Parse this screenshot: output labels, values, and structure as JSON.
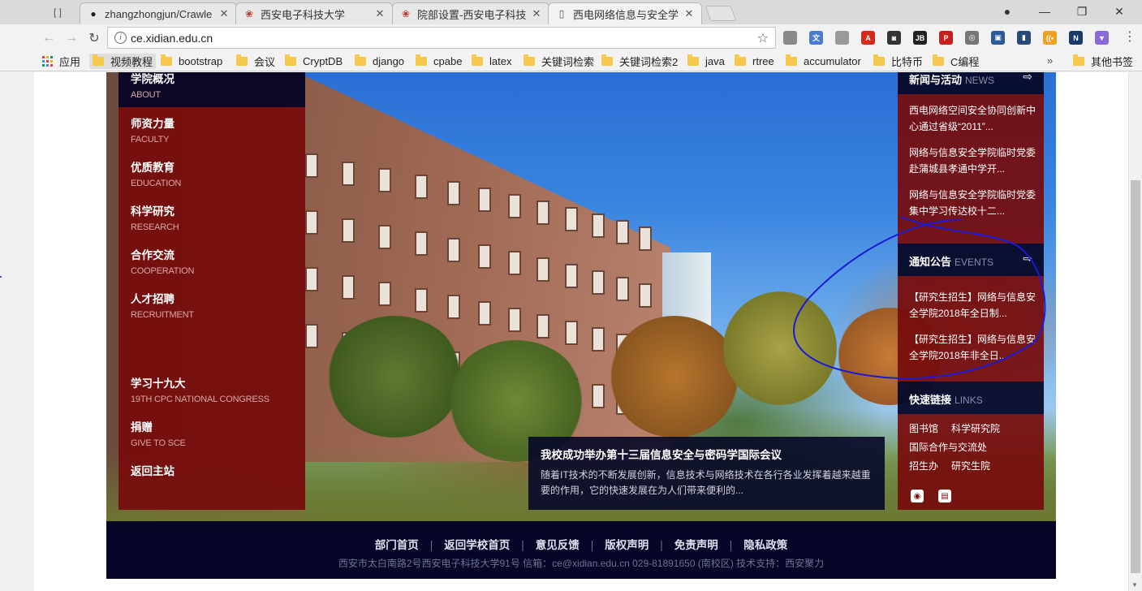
{
  "browser": {
    "tabs": [
      {
        "title": "zhangzhongjun/Crawle",
        "icon": "github-icon",
        "active": false
      },
      {
        "title": "西安电子科技大学",
        "icon": "xidian-logo-icon",
        "active": false
      },
      {
        "title": "院部设置-西安电子科技大",
        "icon": "xidian-logo-icon",
        "active": false
      },
      {
        "title": "西电网络信息与安全学院",
        "icon": "page-icon",
        "active": true
      }
    ],
    "url": "ce.xidian.edu.cn",
    "bookmarks": {
      "apps_label": "应用",
      "items": [
        "视频教程",
        "bootstrap",
        "会议",
        "CryptDB",
        "django",
        "cpabe",
        "latex",
        "关键词检索",
        "关键词检索2",
        "java",
        "rtree",
        "accumulator",
        "比特币",
        "C编程"
      ],
      "more": "»",
      "other": "其他书签"
    },
    "extensions": [
      {
        "name": "shield-ext-icon",
        "color": "#8a8a8a",
        "text": ""
      },
      {
        "name": "translate-ext-icon",
        "color": "#4a7bd4",
        "text": "文"
      },
      {
        "name": "image-ext-icon",
        "color": "#9a9a9a",
        "text": ""
      },
      {
        "name": "pdf-ext-icon",
        "color": "#d42a1e",
        "text": "A"
      },
      {
        "name": "glasses-ext-icon",
        "color": "#333333",
        "text": "◙"
      },
      {
        "name": "jb-ext-icon",
        "color": "#222222",
        "text": "JB"
      },
      {
        "name": "pdf2-ext-icon",
        "color": "#c81e1e",
        "text": "P"
      },
      {
        "name": "globe-ext-icon",
        "color": "#777777",
        "text": "◎"
      },
      {
        "name": "camera-ext-icon",
        "color": "#2a5a9a",
        "text": "▣"
      },
      {
        "name": "chart-ext-icon",
        "color": "#2a4a7a",
        "text": "▮"
      },
      {
        "name": "rss-ext-icon",
        "color": "#f0a020",
        "text": "((•"
      },
      {
        "name": "n-ext-icon",
        "color": "#1a3a6a",
        "text": "N"
      },
      {
        "name": "vue-ext-icon",
        "color": "#8a6ad8",
        "text": "▼"
      }
    ]
  },
  "site": {
    "leftnav": {
      "top": {
        "zh": "学院概况",
        "en": "ABOUT"
      },
      "items": [
        {
          "zh": "师资力量",
          "en": "FACULTY"
        },
        {
          "zh": "优质教育",
          "en": "EDUCATION"
        },
        {
          "zh": "科学研究",
          "en": "RESEARCH"
        },
        {
          "zh": "合作交流",
          "en": "COOPERATION"
        },
        {
          "zh": "人才招聘",
          "en": "RECRUITMENT"
        },
        {
          "zh": "学习十九大",
          "en": "19TH CPC NATIONAL CONGRESS"
        },
        {
          "zh": "捐赠",
          "en": "GIVE TO SCE"
        },
        {
          "zh": "返回主站",
          "en": ""
        }
      ]
    },
    "news": {
      "title": "新闻与活动",
      "title_en": "NEWS",
      "arrow": "⇨",
      "items": [
        "西电网络空间安全协同创新中心通过省级“2011”...",
        "网络与信息安全学院临时党委赴蒲城县孝通中学开...",
        "网络与信息安全学院临时党委集中学习传达校十二..."
      ]
    },
    "events": {
      "title": "通知公告",
      "title_en": "EVENTS",
      "arrow": "⇨",
      "items": [
        "【研究生招生】网络与信息安全学院2018年全日制...",
        "【研究生招生】网络与信息安全学院2018年非全日..."
      ]
    },
    "links": {
      "title": "快速链接",
      "title_en": "LINKS",
      "rows": [
        [
          "图书馆",
          "科学研究院"
        ],
        [
          "国际合作与交流处"
        ],
        [
          "招生办",
          "研究生院"
        ]
      ]
    },
    "caption": {
      "title": "我校成功举办第十三届信息安全与密码学国际会议",
      "body": "随着IT技术的不断发展创新，信息技术与网络技术在各行各业发挥着越来越重要的作用，它的快速发展在为人们带来便利的..."
    },
    "footer": {
      "links": [
        "部门首页",
        "返回学校首页",
        "意见反馈",
        "版权声明",
        "免责声明",
        "隐私政策"
      ],
      "info": "西安市太白南路2号西安电子科技大学91号    信箱：ce@xidian.edu.cn    029-81891650 (南校区)    技术支持：西安聚力"
    }
  }
}
